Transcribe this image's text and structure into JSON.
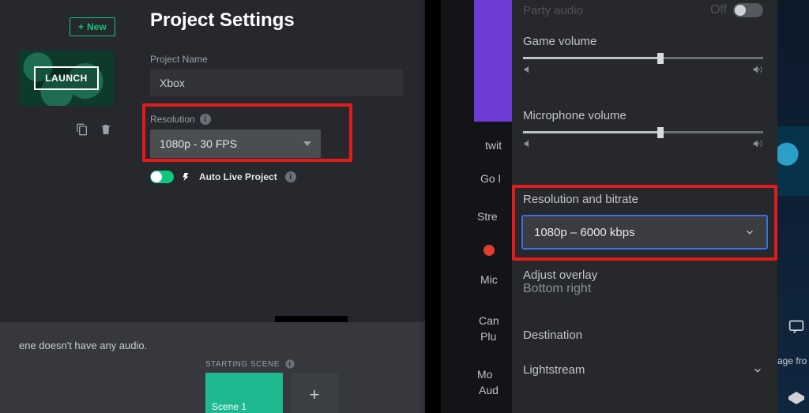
{
  "left": {
    "new_button": "New",
    "launch_button": "LAUNCH",
    "title": "Project Settings",
    "project_name_label": "Project Name",
    "project_name_value": "Xbox",
    "resolution_label": "Resolution",
    "resolution_value": "1080p - 30 FPS",
    "auto_live_label": "Auto Live Project",
    "audio_message": "ene doesn't have any audio.",
    "starting_scene_label": "STARTING SCENE",
    "scene1_label": "Scene 1",
    "add_tile": "+"
  },
  "right": {
    "party_audio_label": "Party audio",
    "party_audio_value": "Off",
    "game_volume_label": "Game volume",
    "mic_volume_label": "Microphone volume",
    "resbit_label": "Resolution and bitrate",
    "resbit_value": "1080p – 6000 kbps",
    "adjust_overlay_label": "Adjust overlay",
    "adjust_overlay_value": "Bottom right",
    "destination_label": "Destination",
    "lightstream_label": "Lightstream",
    "peek": {
      "twitch_partial": "twit",
      "go_partial": "Go l",
      "stream_partial": "Stre",
      "mic_partial": "Mic",
      "camera_partial": "Can",
      "plug_partial": "Plu",
      "more_partial": "Mo",
      "audio_partial": "Aud"
    },
    "far_text": "age fro"
  }
}
